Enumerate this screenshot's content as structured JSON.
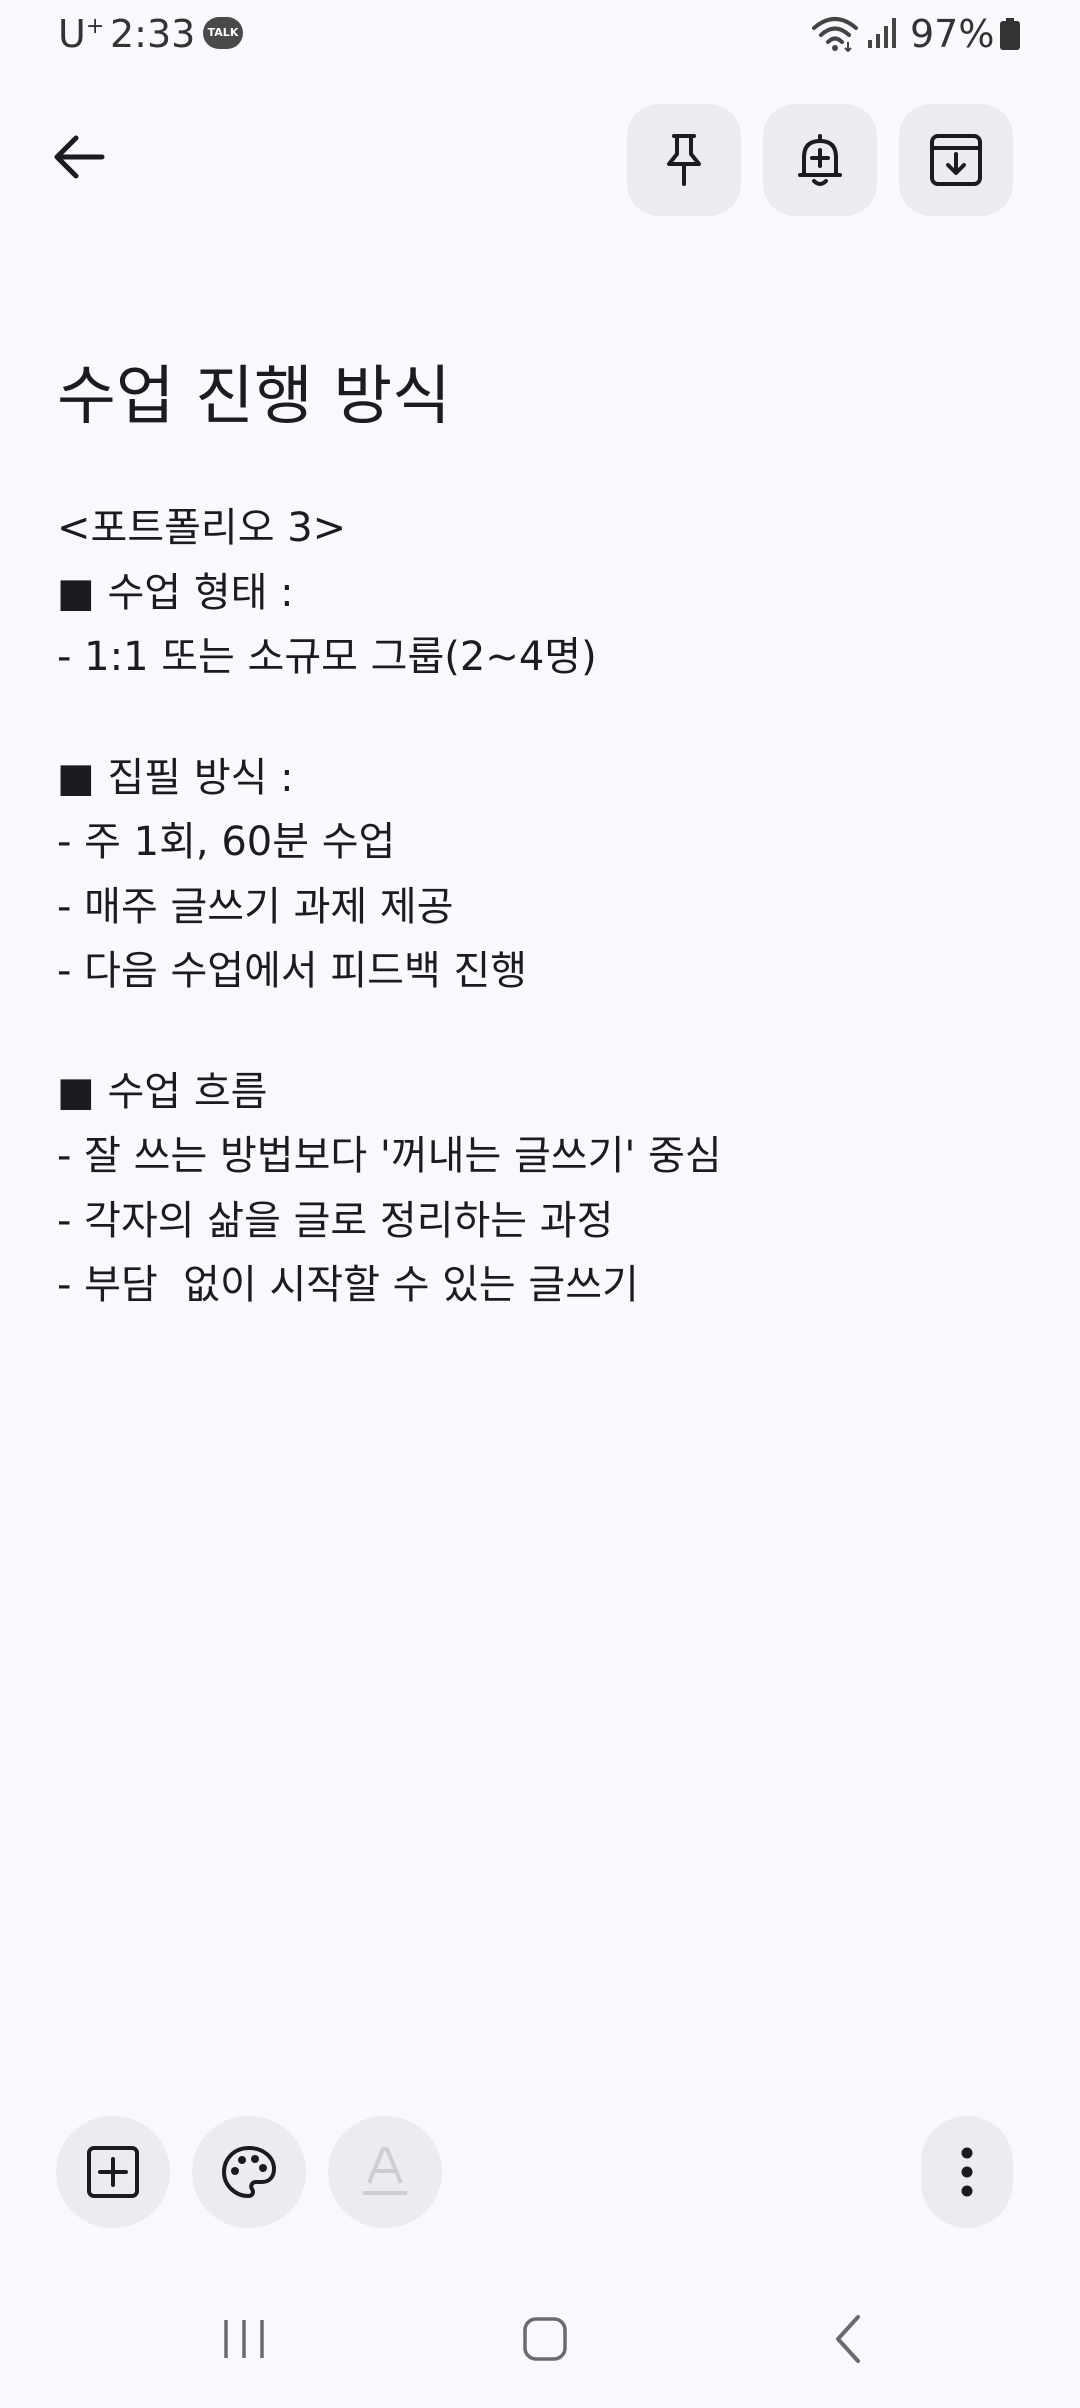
{
  "status_bar": {
    "carrier": "U",
    "carrier_sup": "+",
    "time": "2:33",
    "talk_badge": "TALK",
    "battery": "97%"
  },
  "icons": {
    "back": "arrow-left-icon",
    "pin": "pin-icon",
    "reminder": "bell-plus-icon",
    "archive": "archive-icon",
    "add": "add-box-icon",
    "palette": "palette-icon",
    "text_format": "text-format-icon",
    "more": "more-vertical-icon"
  },
  "note": {
    "title": "수업 진행 방식",
    "lines": [
      "<포트폴리오 3>",
      "■ 수업 형태 :",
      "- 1:1 또는 소규모 그룹(2~4명)",
      "",
      "■ 집필 방식 :",
      "- 주 1회, 60분 수업",
      "- 매주 글쓰기 과제 제공",
      "- 다음 수업에서 피드백 진행",
      "",
      "■ 수업 흐름",
      "- 잘 쓰는 방법보다 '꺼내는 글쓰기' 중심",
      "- 각자의 삶을 글로 정리하는 과정",
      "- 부담  없이 시작할 수 있는 글쓰기"
    ]
  },
  "colors": {
    "background": "#f9f8fd",
    "button_bg": "#ecebf0",
    "text": "#1d1b20",
    "disabled_icon": "#cfcdd4"
  }
}
